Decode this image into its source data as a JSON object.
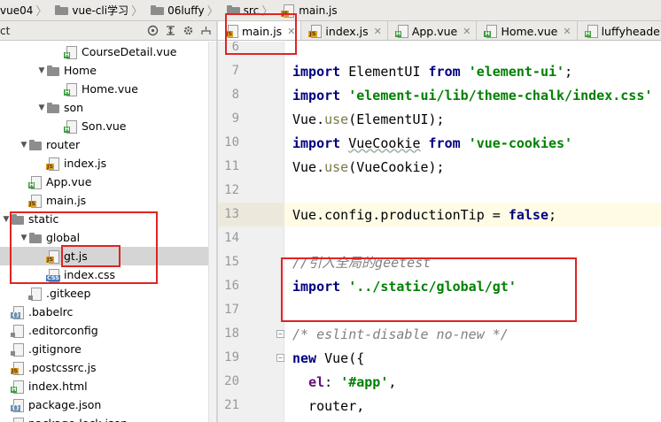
{
  "breadcrumb": [
    "vue04",
    "vue-cli学习",
    "06luffy",
    "src",
    "main.js"
  ],
  "left_toolbar": {
    "partial_label": "ct"
  },
  "tree": [
    {
      "label": "CourseDetail.vue",
      "type": "vue",
      "indent": 4,
      "arrow": ""
    },
    {
      "label": "Home",
      "type": "folder",
      "indent": 3,
      "arrow": "down"
    },
    {
      "label": "Home.vue",
      "type": "vue",
      "indent": 4,
      "arrow": ""
    },
    {
      "label": "son",
      "type": "folder",
      "indent": 3,
      "arrow": "down"
    },
    {
      "label": "Son.vue",
      "type": "vue",
      "indent": 4,
      "arrow": ""
    },
    {
      "label": "router",
      "type": "folder",
      "indent": 2,
      "arrow": "down"
    },
    {
      "label": "index.js",
      "type": "js",
      "indent": 3,
      "arrow": ""
    },
    {
      "label": "App.vue",
      "type": "vue",
      "indent": 2,
      "arrow": ""
    },
    {
      "label": "main.js",
      "type": "js",
      "indent": 2,
      "arrow": ""
    },
    {
      "label": "static",
      "type": "folder",
      "indent": 1,
      "arrow": "down"
    },
    {
      "label": "global",
      "type": "folder",
      "indent": 2,
      "arrow": "down"
    },
    {
      "label": "gt.js",
      "type": "js",
      "indent": 3,
      "arrow": "",
      "selected": true
    },
    {
      "label": "index.css",
      "type": "css",
      "indent": 3,
      "arrow": ""
    },
    {
      "label": ".gitkeep",
      "type": "gen",
      "indent": 2,
      "arrow": ""
    },
    {
      "label": ".babelrc",
      "type": "json",
      "indent": 1,
      "arrow": ""
    },
    {
      "label": ".editorconfig",
      "type": "gen",
      "indent": 1,
      "arrow": ""
    },
    {
      "label": ".gitignore",
      "type": "gen",
      "indent": 1,
      "arrow": ""
    },
    {
      "label": ".postcssrc.js",
      "type": "js",
      "indent": 1,
      "arrow": ""
    },
    {
      "label": "index.html",
      "type": "html",
      "indent": 1,
      "arrow": ""
    },
    {
      "label": "package.json",
      "type": "json",
      "indent": 1,
      "arrow": ""
    },
    {
      "label": "package-lock.json",
      "type": "json",
      "indent": 1,
      "arrow": ""
    }
  ],
  "tabs": [
    {
      "label": "main.js",
      "type": "js",
      "active": true
    },
    {
      "label": "index.js",
      "type": "js",
      "active": false
    },
    {
      "label": "App.vue",
      "type": "vue",
      "active": false
    },
    {
      "label": "Home.vue",
      "type": "vue",
      "active": false
    },
    {
      "label": "luffyheader.vue",
      "type": "vue",
      "active": false
    }
  ],
  "editor": {
    "highlighted_line": 13,
    "lines": [
      {
        "n": 6,
        "tokens": []
      },
      {
        "n": 7,
        "tokens": [
          [
            "kw",
            "import"
          ],
          [
            "plain",
            " ElementUI "
          ],
          [
            "kw",
            "from"
          ],
          [
            "plain",
            " "
          ],
          [
            "str",
            "'element-ui'"
          ],
          [
            "plain",
            ";"
          ]
        ]
      },
      {
        "n": 8,
        "tokens": [
          [
            "kw",
            "import"
          ],
          [
            "plain",
            " "
          ],
          [
            "str",
            "'element-ui/lib/theme-chalk/index.css'"
          ]
        ]
      },
      {
        "n": 9,
        "tokens": [
          [
            "plain",
            "Vue."
          ],
          [
            "fn",
            "use"
          ],
          [
            "plain",
            "(ElementUI);"
          ]
        ]
      },
      {
        "n": 10,
        "tokens": [
          [
            "kw",
            "import"
          ],
          [
            "plain",
            " "
          ],
          [
            "sq",
            "VueCookie"
          ],
          [
            "plain",
            " "
          ],
          [
            "kw",
            "from"
          ],
          [
            "plain",
            " "
          ],
          [
            "str",
            "'vue-cookies'"
          ]
        ]
      },
      {
        "n": 11,
        "tokens": [
          [
            "plain",
            "Vue."
          ],
          [
            "fn",
            "use"
          ],
          [
            "plain",
            "(VueCookie);"
          ]
        ]
      },
      {
        "n": 12,
        "tokens": []
      },
      {
        "n": 13,
        "tokens": [
          [
            "plain",
            "Vue.config.productionTip = "
          ],
          [
            "kw",
            "false"
          ],
          [
            "plain",
            ";"
          ]
        ]
      },
      {
        "n": 14,
        "tokens": []
      },
      {
        "n": 15,
        "tokens": [
          [
            "cmt",
            "//引入全局的geetest"
          ]
        ]
      },
      {
        "n": 16,
        "tokens": [
          [
            "kw",
            "import"
          ],
          [
            "plain",
            " "
          ],
          [
            "str",
            "'../static/global/gt'"
          ]
        ]
      },
      {
        "n": 17,
        "tokens": []
      },
      {
        "n": 18,
        "tokens": [
          [
            "cmt",
            "/* eslint-disable no-new */"
          ]
        ]
      },
      {
        "n": 19,
        "tokens": [
          [
            "kw",
            "new"
          ],
          [
            "plain",
            " Vue({"
          ]
        ]
      },
      {
        "n": 20,
        "tokens": [
          [
            "plain",
            "  "
          ],
          [
            "prop",
            "el"
          ],
          [
            "plain",
            ": "
          ],
          [
            "str",
            "'#app'"
          ],
          [
            "plain",
            ","
          ]
        ]
      },
      {
        "n": 21,
        "tokens": [
          [
            "plain",
            "  router,"
          ]
        ]
      }
    ]
  }
}
